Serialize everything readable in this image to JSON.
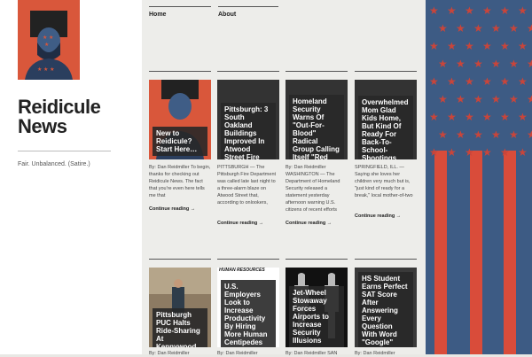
{
  "site": {
    "title_line1": "Reidicule",
    "title_line2": "News",
    "tagline": "Fair. Unbalanced. (Satire.)"
  },
  "nav": [
    {
      "label": "Home"
    },
    {
      "label": "About"
    }
  ],
  "posts": [
    {
      "title": "New to Reidicule? Start Here…",
      "excerpt": "By: Dan Reidmiller To begin, thanks for checking out Reidicule News. The fact that you're even here tells me that",
      "more": "Continue reading →"
    },
    {
      "title": "Pittsburgh: 3 South Oakland Buildings Improved In Atwood Street Fire",
      "excerpt": "PITTSBURGH — The Pittsburgh Fire Department was called late last night to a three-alarm blaze on Atwood Street that, according to onlookers,",
      "more": "Continue reading →"
    },
    {
      "title": "Homeland Security Warns Of \"Out-For-Blood\" Radical Group Calling Itself \"Red Cross\"",
      "excerpt": "By: Dan Reidmiller WASHINGTON — The Department of Homeland Security released a statement yesterday afternoon warning U.S. citizens of recent efforts",
      "more": "Continue reading →"
    },
    {
      "title": "Overwhelmed Mom Glad Kids Home, But Kind Of Ready For Back-To-School-Shootings Season",
      "excerpt": "SPRINGFIELD, ILL. — Saying she loves her children very much but is, \"just kind of ready for a break,\" local mother-of-two",
      "more": "Continue reading →"
    },
    {
      "title": "Pittsburgh PUC Halts Ride-Sharing At Kennywood",
      "excerpt": "By: Dan Reidmiller",
      "more": ""
    },
    {
      "title": "U.S. Employers Look to Increase Productivity By Hiring More Human Centipedes",
      "excerpt": "By: Dan Reidmiller",
      "more": "",
      "thumb_caption": "HUMAN RESOURCES"
    },
    {
      "title": "Jet-Wheel Stowaway Forces Airports to Increase Security Illusions",
      "excerpt": "By: Dan Reidmiller SAN",
      "more": ""
    },
    {
      "title": "HS Student Earns Perfect SAT Score After Answering Every Question With Word \"Google\"",
      "excerpt": "By: Dan Reidmiller",
      "more": ""
    }
  ],
  "colors": {
    "accent_red": "#d9573b",
    "flag_blue": "#3d5b84",
    "flag_red": "#d94c3a"
  }
}
